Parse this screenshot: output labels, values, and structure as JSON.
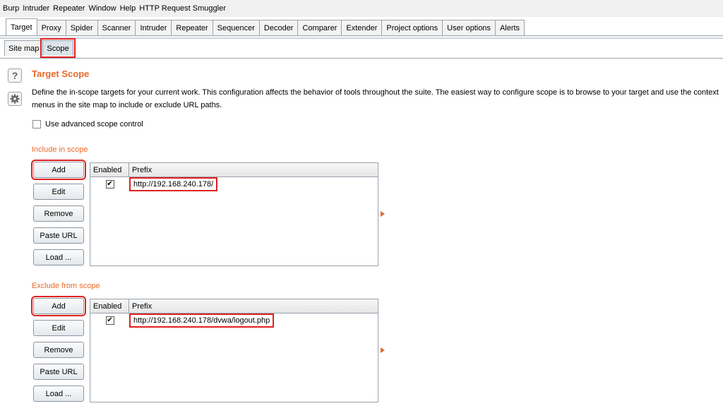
{
  "menubar": [
    "Burp",
    "Intruder",
    "Repeater",
    "Window",
    "Help",
    "HTTP Request Smuggler"
  ],
  "main_tabs": [
    "Target",
    "Proxy",
    "Spider",
    "Scanner",
    "Intruder",
    "Repeater",
    "Sequencer",
    "Decoder",
    "Comparer",
    "Extender",
    "Project options",
    "User options",
    "Alerts"
  ],
  "active_main_tab": "Target",
  "sub_tabs": [
    "Site map",
    "Scope"
  ],
  "active_sub_tab": "Scope",
  "icons": {
    "help": "?",
    "settings": "gear-icon"
  },
  "page": {
    "title": "Target Scope",
    "description": "Define the in-scope targets for your current work. This configuration affects the behavior of tools throughout the suite. The easiest way to configure scope is to browse to your target and use the context menus in the site map to include or exclude URL paths.",
    "advanced_label": "Use advanced scope control",
    "advanced_checked": false
  },
  "include": {
    "label": "Include in scope",
    "buttons": {
      "add": "Add",
      "edit": "Edit",
      "remove": "Remove",
      "paste": "Paste URL",
      "load": "Load ..."
    },
    "columns": {
      "enabled": "Enabled",
      "prefix": "Prefix"
    },
    "rows": [
      {
        "enabled": true,
        "check": "✔",
        "prefix": "http://192.168.240.178/"
      }
    ]
  },
  "exclude": {
    "label": "Exclude from scope",
    "buttons": {
      "add": "Add",
      "edit": "Edit",
      "remove": "Remove",
      "paste": "Paste URL",
      "load": "Load ..."
    },
    "columns": {
      "enabled": "Enabled",
      "prefix": "Prefix"
    },
    "rows": [
      {
        "enabled": true,
        "check": "✔",
        "prefix": "http://192.168.240.178/dvwa/logout.php"
      }
    ]
  },
  "colors": {
    "accent": "#e8692a",
    "highlight": "#e02020"
  }
}
